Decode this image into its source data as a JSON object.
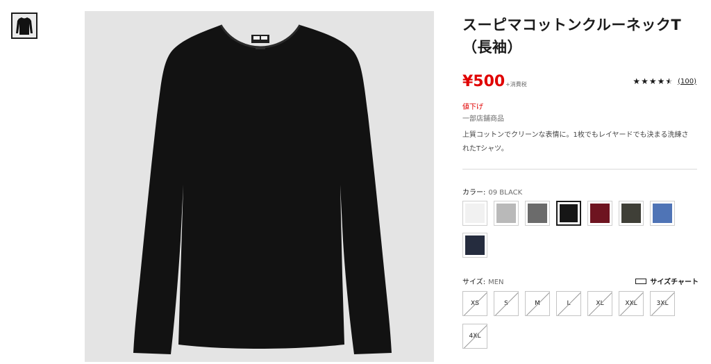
{
  "product": {
    "title": "スーピマコットンクルーネックT（長袖）",
    "price": "¥500",
    "tax_note": "+消費税",
    "rating": {
      "stars": 4.5,
      "review_count": "(100)"
    },
    "flags": {
      "sale": "値下げ",
      "store": "一部店舗商品"
    },
    "description": "上質コットンでクリーンな表情に。1枚でもレイヤードでも決まる洗練されたTシャツ。"
  },
  "color": {
    "label": "カラー:",
    "selected_value": "09 BLACK",
    "swatches": [
      {
        "name": "white",
        "hex": "#f1f1f1"
      },
      {
        "name": "light-gray-heather",
        "hex": "#b9b9b9"
      },
      {
        "name": "dark-gray-heather",
        "hex": "#6b6b6b"
      },
      {
        "name": "black",
        "hex": "#161616",
        "selected": true
      },
      {
        "name": "wine",
        "hex": "#6e1420"
      },
      {
        "name": "olive",
        "hex": "#3f3f37"
      },
      {
        "name": "blue-heather",
        "hex": "#4f74b6"
      },
      {
        "name": "navy",
        "hex": "#252c3e"
      }
    ]
  },
  "size": {
    "label": "サイズ:",
    "gender": "MEN",
    "chart_link": "サイズチャート",
    "options": [
      "XS",
      "S",
      "M",
      "L",
      "XL",
      "XXL",
      "3XL",
      "4XL"
    ],
    "available": false
  },
  "colors": {
    "price_red": "#e00000",
    "text": "#1b1b1b",
    "image_background": "#e4e4e4",
    "product_color": "#121212"
  }
}
